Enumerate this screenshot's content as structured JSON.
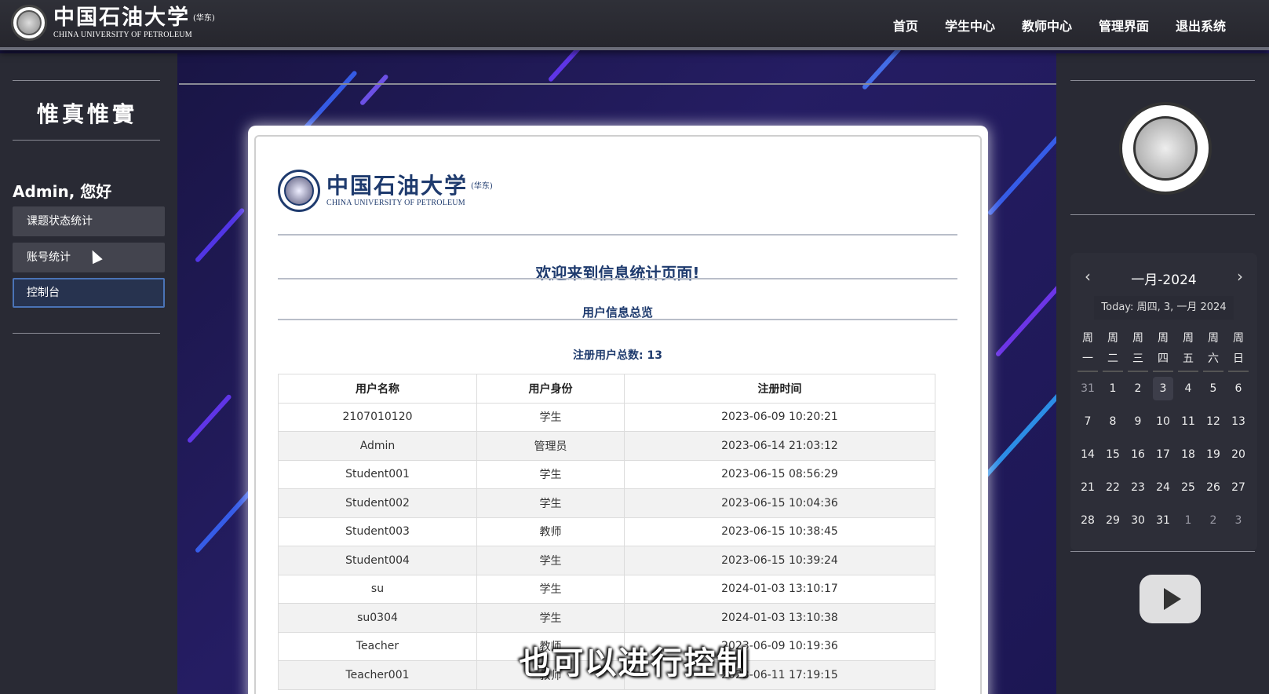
{
  "header": {
    "brand_cn": "中国石油大学",
    "brand_tag": "(华东)",
    "brand_en": "CHINA UNIVERSITY OF PETROLEUM",
    "nav": [
      "首页",
      "学生中心",
      "教师中心",
      "管理界面",
      "退出系统"
    ]
  },
  "sidebar": {
    "motto": "惟真惟實",
    "greeting": "Admin, 您好",
    "items": [
      "课题状态统计",
      "账号统计",
      "控制台"
    ],
    "active_index": 2
  },
  "card": {
    "brand_cn": "中国石油大学",
    "brand_tag": "(华东)",
    "brand_en": "CHINA UNIVERSITY OF PETROLEUM",
    "welcome": "欢迎来到信息统计页面!",
    "section_title": "用户信息总览",
    "count_label": "注册用户总数:",
    "count_value": "13",
    "columns": [
      "用户名称",
      "用户身份",
      "注册时间"
    ],
    "rows": [
      [
        "2107010120",
        "学生",
        "2023-06-09 10:20:21"
      ],
      [
        "Admin",
        "管理员",
        "2023-06-14 21:03:12"
      ],
      [
        "Student001",
        "学生",
        "2023-06-15 08:56:29"
      ],
      [
        "Student002",
        "学生",
        "2023-06-15 10:04:36"
      ],
      [
        "Student003",
        "教师",
        "2023-06-15 10:38:45"
      ],
      [
        "Student004",
        "学生",
        "2023-06-15 10:39:24"
      ],
      [
        "su",
        "学生",
        "2024-01-03 13:10:17"
      ],
      [
        "su0304",
        "学生",
        "2024-01-03 13:10:38"
      ],
      [
        "Teacher",
        "教师",
        "2023-06-09 10:19:36"
      ],
      [
        "Teacher001",
        "教师",
        "2023-06-11 17:19:15"
      ]
    ]
  },
  "calendar": {
    "title": "一月-2024",
    "today_text": "Today: 周四, 3, 一月 2024",
    "weekdays": [
      [
        "周",
        "一"
      ],
      [
        "周",
        "二"
      ],
      [
        "周",
        "三"
      ],
      [
        "周",
        "四"
      ],
      [
        "周",
        "五"
      ],
      [
        "周",
        "六"
      ],
      [
        "周",
        "日"
      ]
    ],
    "days": [
      [
        "31",
        "1",
        "2",
        "3",
        "4",
        "5",
        "6"
      ],
      [
        "7",
        "8",
        "9",
        "10",
        "11",
        "12",
        "13"
      ],
      [
        "14",
        "15",
        "16",
        "17",
        "18",
        "19",
        "20"
      ],
      [
        "21",
        "22",
        "23",
        "24",
        "25",
        "26",
        "27"
      ],
      [
        "28",
        "29",
        "30",
        "31",
        "1",
        "2",
        "3"
      ]
    ],
    "today_value": "3"
  },
  "overlay": {
    "caption": "也可以进行控制"
  },
  "colors": {
    "accent": "#1f3b6e",
    "active_border": "#4a73b6",
    "panel": "#292a34"
  }
}
